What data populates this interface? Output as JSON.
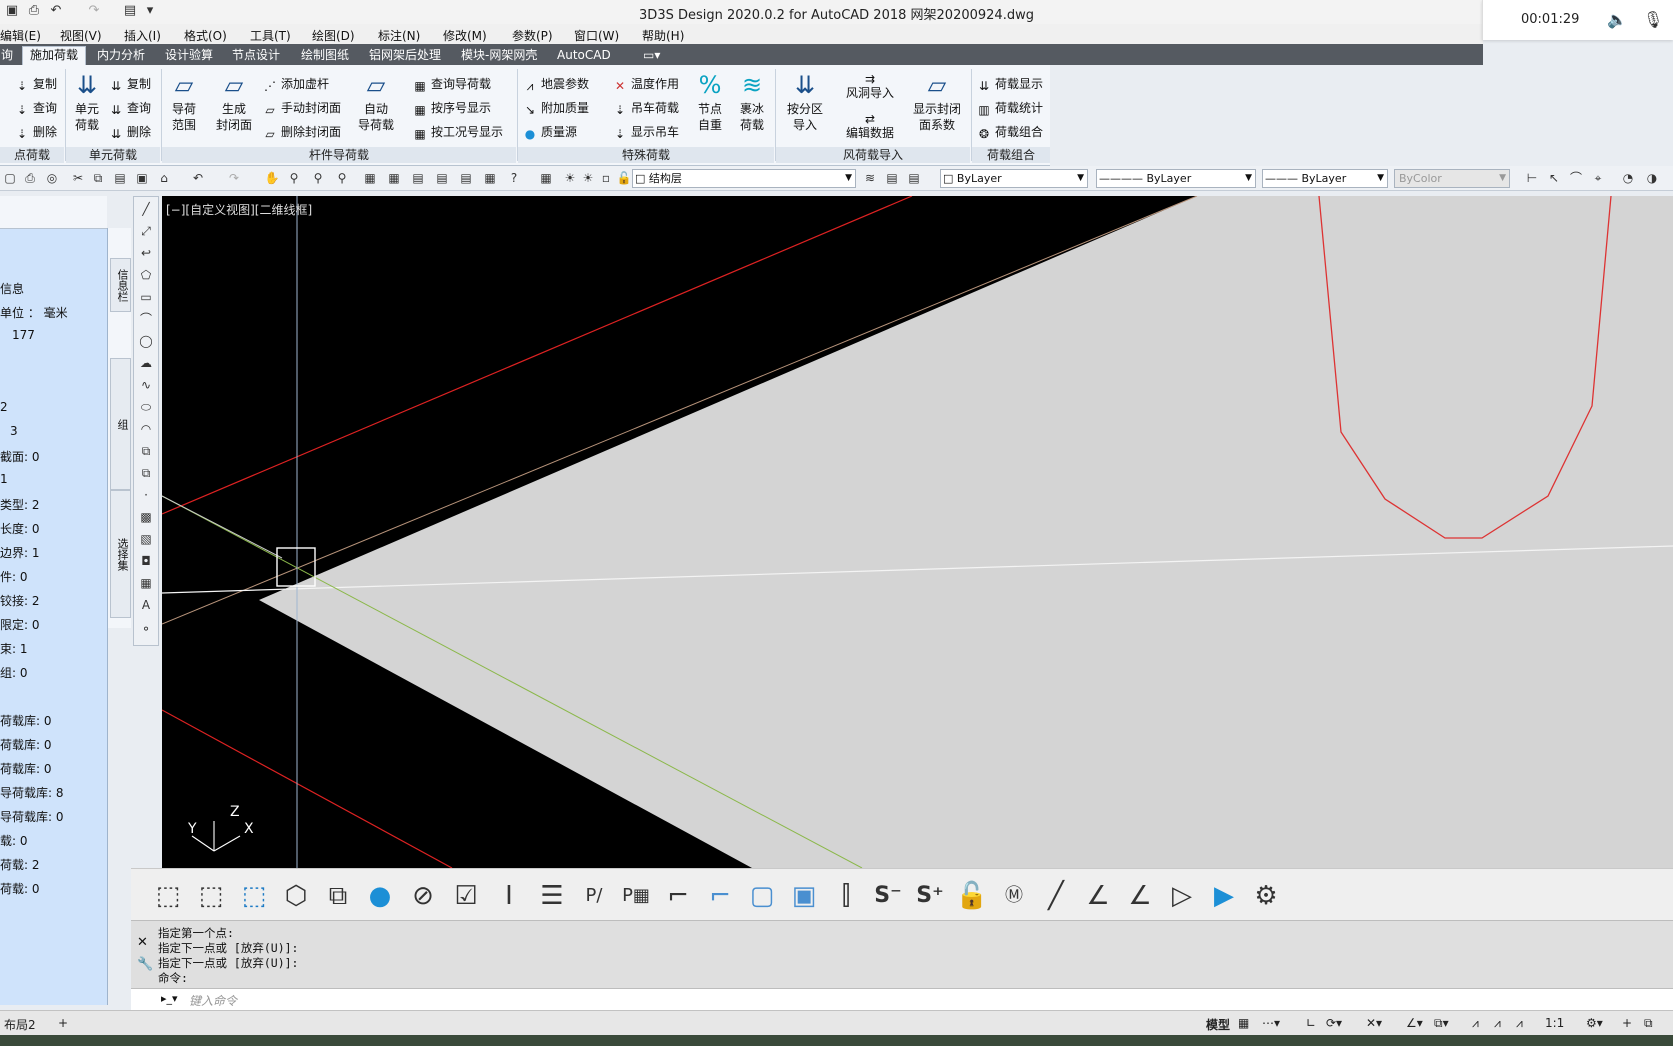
{
  "title_bar": {
    "title": "3D3S Design 2020.0.2 for AutoCAD 2018    网架20200924.dwg",
    "quick_access_icons": [
      "save-icon",
      "print-icon",
      "undo-icon",
      "redo-icon",
      "workspace-icon",
      "dropdown-icon"
    ]
  },
  "recorder": {
    "time": "00:01:29"
  },
  "menu": [
    "编辑(E)",
    "视图(V)",
    "插入(I)",
    "格式(O)",
    "工具(T)",
    "绘图(D)",
    "标注(N)",
    "修改(M)",
    "参数(P)",
    "窗口(W)",
    "帮助(H)"
  ],
  "ribbon_tabs": {
    "items": [
      "询",
      "施加荷载",
      "内力分析",
      "设计验算",
      "节点设计",
      "绘制图纸",
      "铝网架后处理",
      "模块-网架网壳",
      "AutoCAD"
    ],
    "active": "施加荷载"
  },
  "ribbon": {
    "node_load": {
      "title": "点荷载",
      "copy": "复制",
      "query": "查询",
      "delete": "删除"
    },
    "unit_load": {
      "title": "单元荷载",
      "big": "单元\n荷载",
      "copy": "复制",
      "query": "查询",
      "delete": "删除"
    },
    "member_guide": {
      "title": "杆件导荷载",
      "range": "导荷\n范围",
      "gen_face": "生成\n封闭面",
      "add_virtual": "添加虚杆",
      "manual_face": "手动封闭面",
      "del_face": "删除封闭面",
      "auto": "自动\n导荷载",
      "query_guide": "查询导荷载",
      "by_seq": "按序号显示",
      "by_case": "按工况号显示"
    },
    "special": {
      "title": "特殊荷载",
      "seismic": "地震参数",
      "add_mass": "附加质量",
      "mass_src": "质量源",
      "temp": "温度作用",
      "crane": "吊车荷载",
      "show_crane": "显示吊车",
      "node_self": "节点\n自重",
      "ice": "裹冰\n荷载"
    },
    "wind": {
      "title": "风荷载导入",
      "by_zone": "按分区\n导入",
      "tunnel": "风洞导入",
      "edit": "编辑数据",
      "coef": "显示封闭\n面系数"
    },
    "combo": {
      "title": "荷载组合",
      "show": "荷载显示",
      "stats": "荷载统计",
      "comb": "荷载组合"
    }
  },
  "toolbar": {
    "layer": "结构层",
    "color": "ByLayer",
    "linetype": "ByLayer",
    "lineweight": "ByLayer",
    "plotstyle": "ByColor"
  },
  "left_panel": {
    "tabs": [
      "信息栏",
      "组",
      "选择集"
    ],
    "lines": [
      "信息",
      "单位 ： 毫米",
      "177",
      "",
      "",
      "2",
      "3",
      "截面: 0",
      "1",
      "类型: 2",
      "长度: 0",
      "边界: 1",
      "件: 0",
      "铰接: 2",
      "限定: 0",
      "束: 1",
      "组: 0",
      "",
      "荷载库: 0",
      "荷载库: 0",
      "荷载库: 0",
      "导荷载库: 8",
      "导荷载库: 0",
      "载: 0",
      "荷载: 2",
      "荷载: 0"
    ]
  },
  "viewport": {
    "label": "[−][自定义视图][二维线框]",
    "ucs": {
      "x": "X",
      "y": "Y",
      "z": "Z"
    }
  },
  "command": {
    "history": [
      "指定第一个点:",
      "指定下一点或 [放弃(U)]:",
      "指定下一点或 [放弃(U)]:",
      "命令:"
    ],
    "placeholder": "键入命令"
  },
  "status": {
    "layout_tab": "布局2",
    "model": "模型",
    "scale": "1:1"
  }
}
